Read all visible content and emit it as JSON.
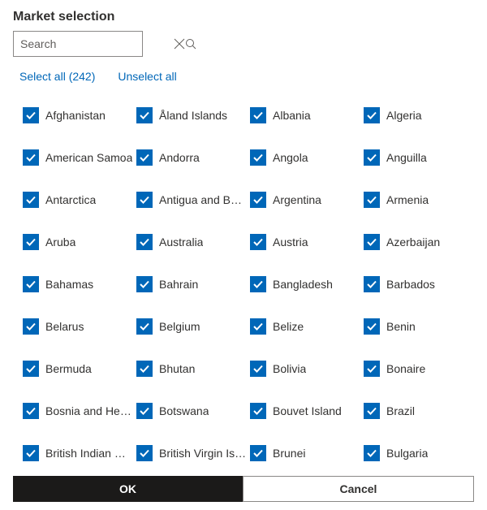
{
  "title": "Market selection",
  "search": {
    "placeholder": "Search",
    "value": ""
  },
  "select_all_label": "Select all (242)",
  "unselect_all_label": "Unselect all",
  "ok_label": "OK",
  "cancel_label": "Cancel",
  "markets": [
    {
      "name": "Afghanistan",
      "checked": true
    },
    {
      "name": "Åland Islands",
      "checked": true
    },
    {
      "name": "Albania",
      "checked": true
    },
    {
      "name": "Algeria",
      "checked": true
    },
    {
      "name": "American Samoa",
      "checked": true
    },
    {
      "name": "Andorra",
      "checked": true
    },
    {
      "name": "Angola",
      "checked": true
    },
    {
      "name": "Anguilla",
      "checked": true
    },
    {
      "name": "Antarctica",
      "checked": true
    },
    {
      "name": "Antigua and Barbuda",
      "checked": true
    },
    {
      "name": "Argentina",
      "checked": true
    },
    {
      "name": "Armenia",
      "checked": true
    },
    {
      "name": "Aruba",
      "checked": true
    },
    {
      "name": "Australia",
      "checked": true
    },
    {
      "name": "Austria",
      "checked": true
    },
    {
      "name": "Azerbaijan",
      "checked": true
    },
    {
      "name": "Bahamas",
      "checked": true
    },
    {
      "name": "Bahrain",
      "checked": true
    },
    {
      "name": "Bangladesh",
      "checked": true
    },
    {
      "name": "Barbados",
      "checked": true
    },
    {
      "name": "Belarus",
      "checked": true
    },
    {
      "name": "Belgium",
      "checked": true
    },
    {
      "name": "Belize",
      "checked": true
    },
    {
      "name": "Benin",
      "checked": true
    },
    {
      "name": "Bermuda",
      "checked": true
    },
    {
      "name": "Bhutan",
      "checked": true
    },
    {
      "name": "Bolivia",
      "checked": true
    },
    {
      "name": "Bonaire",
      "checked": true
    },
    {
      "name": "Bosnia and Herzegovina",
      "checked": true
    },
    {
      "name": "Botswana",
      "checked": true
    },
    {
      "name": "Bouvet Island",
      "checked": true
    },
    {
      "name": "Brazil",
      "checked": true
    },
    {
      "name": "British Indian Ocean Territory",
      "checked": true
    },
    {
      "name": "British Virgin Islands",
      "checked": true
    },
    {
      "name": "Brunei",
      "checked": true
    },
    {
      "name": "Bulgaria",
      "checked": true
    }
  ]
}
